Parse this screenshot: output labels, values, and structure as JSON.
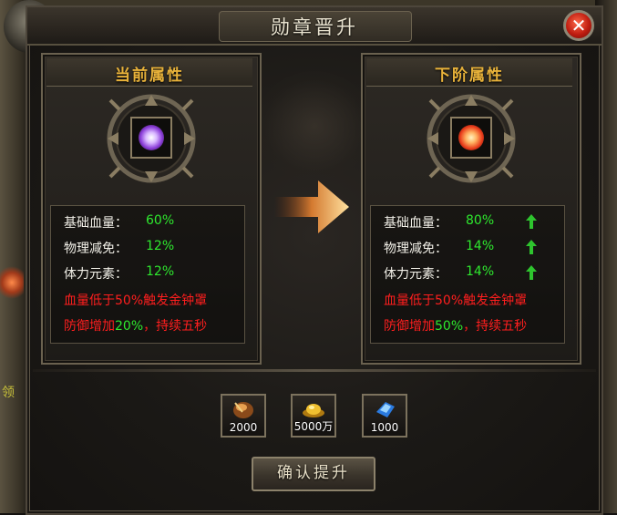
{
  "window": {
    "title": "勋章晋升",
    "close_label": "✕"
  },
  "world": {
    "side_text": "领"
  },
  "current": {
    "header": "当前属性",
    "orb_color": "#9a4ae0",
    "stats": [
      {
        "label": "基础血量：",
        "value": "60%"
      },
      {
        "label": "物理减免：",
        "value": "12%"
      },
      {
        "label": "体力元素：",
        "value": "12%"
      }
    ],
    "effect1": "血量低于50%触发金钟罩",
    "effect2_pre": "防御增加",
    "effect2_hl": "20%",
    "effect2_post": "，持续五秒"
  },
  "next": {
    "header": "下阶属性",
    "orb_color": "#e83a1a",
    "stats": [
      {
        "label": "基础血量：",
        "value": "80%"
      },
      {
        "label": "物理减免：",
        "value": "14%"
      },
      {
        "label": "体力元素：",
        "value": "14%"
      }
    ],
    "effect1": "血量低于50%触发金钟罩",
    "effect2_pre": "防御增加",
    "effect2_hl": "50%",
    "effect2_post": "，持续五秒"
  },
  "costs": [
    {
      "icon": "medal-material-icon",
      "qty": "2000"
    },
    {
      "icon": "gold-ingot-icon",
      "qty": "5000万"
    },
    {
      "icon": "blue-crystal-icon",
      "qty": "1000"
    }
  ],
  "confirm_label": "确认提升",
  "colors": {
    "header_gold": "#e8b23a",
    "value_green": "#2ee82e",
    "effect_red": "#ff1e1e"
  }
}
